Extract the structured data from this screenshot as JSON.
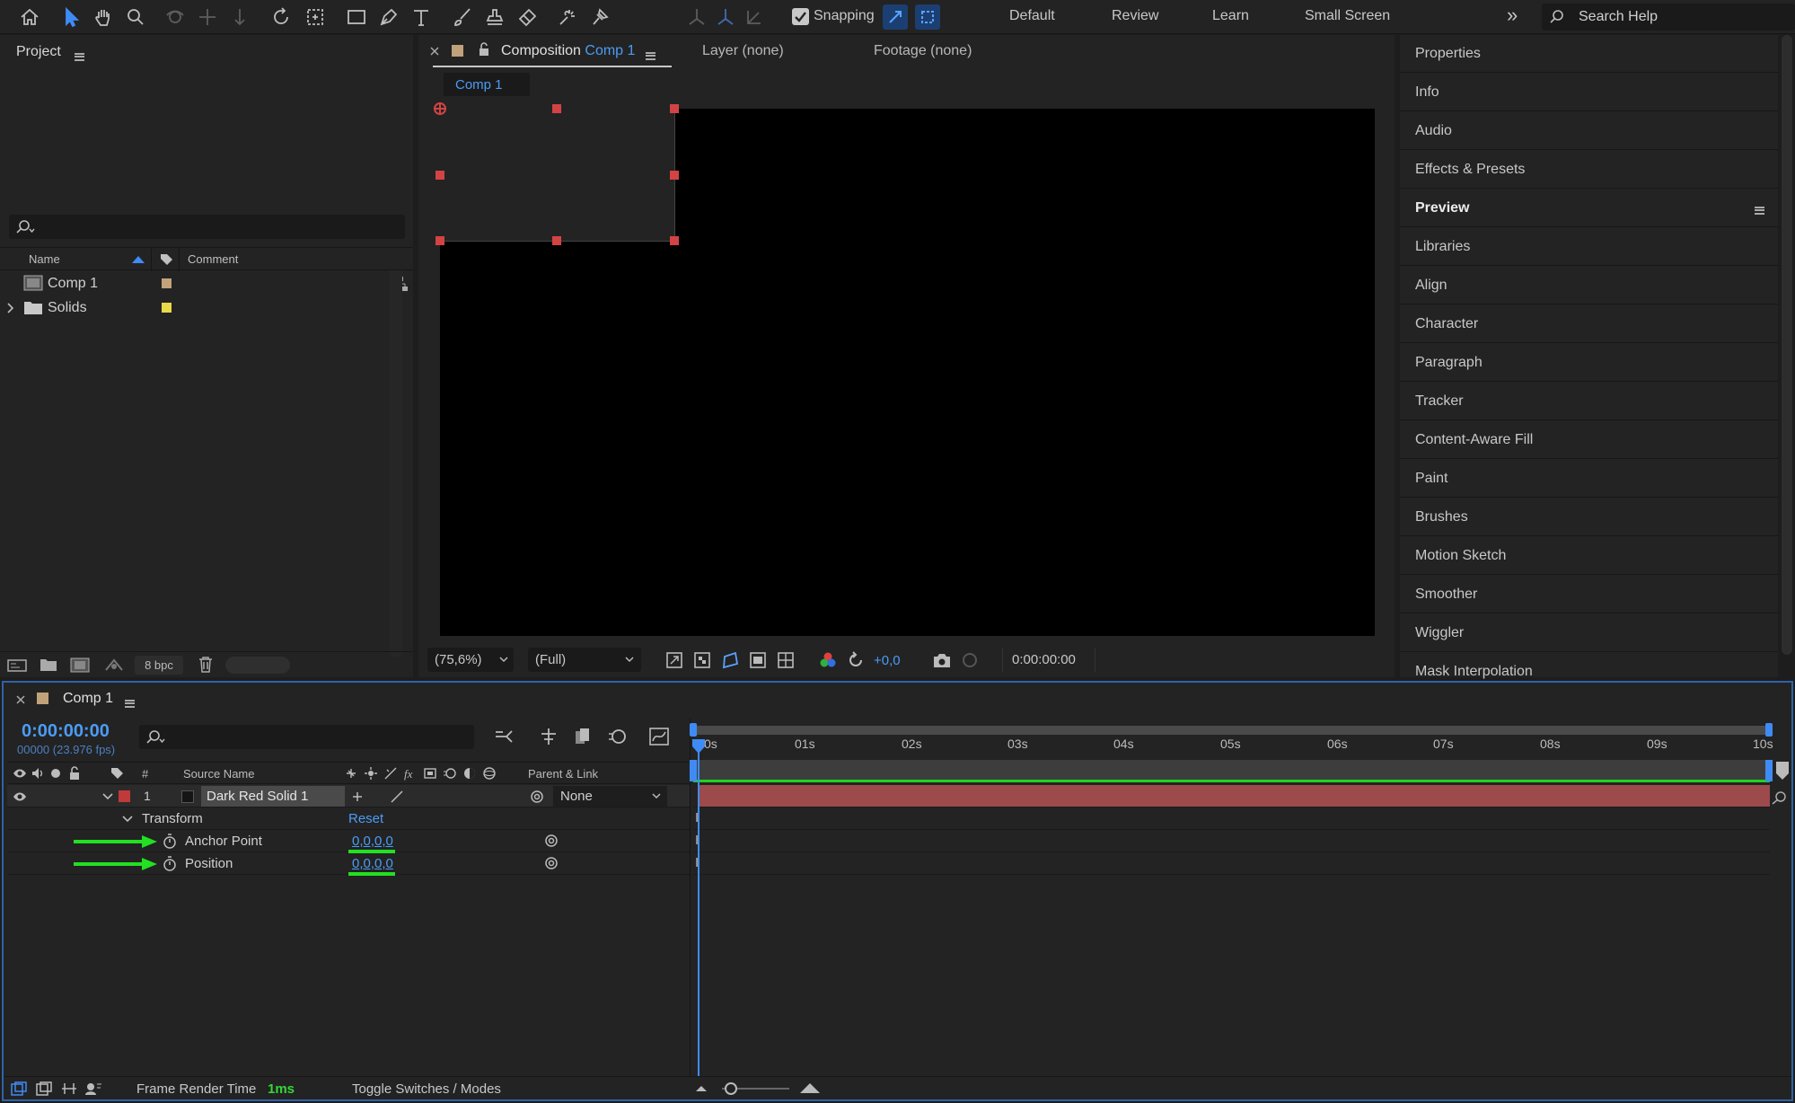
{
  "toolbar": {
    "snapping_label": "Snapping",
    "workspaces": [
      "Default",
      "Review",
      "Learn",
      "Small Screen"
    ],
    "search_placeholder": "Search Help",
    "more": "»"
  },
  "project": {
    "title": "Project",
    "columns": {
      "name": "Name",
      "comment": "Comment"
    },
    "items": [
      {
        "name": "Comp 1",
        "label_color": "#c2a27a"
      },
      {
        "name": "Solids",
        "label_color": "#e8d84a"
      }
    ],
    "bpc": "8 bpc"
  },
  "composition": {
    "tab_prefix": "Composition",
    "tab_name": "Comp 1",
    "layer_tab": "Layer (none)",
    "footage_tab": "Footage (none)",
    "breadcrumb": "Comp 1",
    "zoom": "(75,6%)",
    "resolution": "(Full)",
    "exposure": "+0,0",
    "timecode": "0:00:00:00"
  },
  "right_panels": [
    "Properties",
    "Info",
    "Audio",
    "Effects & Presets",
    "Preview",
    "Libraries",
    "Align",
    "Character",
    "Paragraph",
    "Tracker",
    "Content-Aware Fill",
    "Paint",
    "Brushes",
    "Motion Sketch",
    "Smoother",
    "Wiggler",
    "Mask Interpolation"
  ],
  "timeline": {
    "comp_name": "Comp 1",
    "timecode": "0:00:00:00",
    "frame_info": "00000 (23.976 fps)",
    "columns": {
      "num": "#",
      "source": "Source Name",
      "parent": "Parent & Link"
    },
    "layer": {
      "num": "1",
      "name": "Dark Red Solid 1",
      "parent": "None",
      "label_color": "#c03a3a"
    },
    "transform": {
      "label": "Transform",
      "reset": "Reset",
      "properties": [
        {
          "name": "Anchor Point",
          "value": "0,0,0,0"
        },
        {
          "name": "Position",
          "value": "0,0,0,0"
        }
      ]
    },
    "ruler": [
      "0s",
      "01s",
      "02s",
      "03s",
      "04s",
      "05s",
      "06s",
      "07s",
      "08s",
      "09s",
      "10s"
    ],
    "footer": {
      "render_label": "Frame Render Time",
      "render_value": "1ms",
      "toggle": "Toggle Switches / Modes"
    }
  },
  "colors": {
    "accent": "#3f8bf5",
    "annotation": "#22e022",
    "layer_bar": "#9c4a4c",
    "handle": "#d34343"
  }
}
